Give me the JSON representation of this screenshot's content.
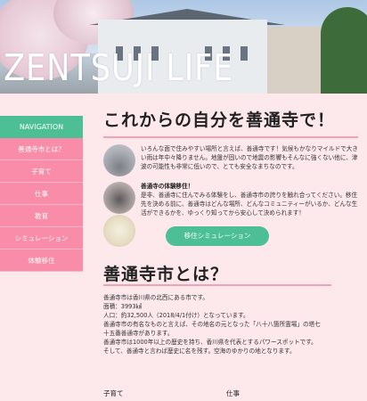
{
  "header": {
    "title": "ZENTSUJI LIFE"
  },
  "nav": {
    "heading": "NAVIGATION",
    "items": [
      {
        "label": "善通寺市とは？"
      },
      {
        "label": "子育て"
      },
      {
        "label": "仕事"
      },
      {
        "label": "教育"
      },
      {
        "label": "シミュレーション"
      },
      {
        "label": "体験移住"
      }
    ]
  },
  "intro": {
    "heading": "これからの自分を善通寺で！",
    "paragraph1": "いろんな面で住みやすい場所と言えば、善通寺です！気候もかなりマイルドで大きい雨は年中々降りません。地盤が固いので地震の影響もそんなに強くない他に、津波の可能性も非常に低いので、とても安全なまちなのです。",
    "experience_title": "善通寺の体験移住！",
    "experience_text": "是非、善通寺に住んでみる体験をし、善通寺市の誇りを触れ合ってください。移住先を決める前に、善通寺はどんな場所、どんなコミュニティーがいるか、どんな生活ができるかを、ゆっくり知ってから安心して決められます！",
    "button_label": "移住シミュレーション"
  },
  "about": {
    "heading": "善通寺市とは？",
    "lines": [
      "善通寺市は香川県の北西にある市です。",
      "面積：3993㎢",
      "人口：約32,500人（2018/4/1付け）となっています。",
      "善通寺市の有名なものと言えば、その地名の元となった「八十八箇所霊場」の塔七",
      "十五番善通寺があります。",
      "善通寺市は1000年以上の歴史を持ち、香川県を代表とするパワースポットです。",
      "そして、善通寺と言わば歴史に名を残す。空海のゆかりの地となります。"
    ]
  },
  "sections": {
    "left": "子育て",
    "right": "仕事"
  },
  "colors": {
    "background": "#fde8ec",
    "accent_green": "#4cbf96",
    "nav_pink": "#f98ca8",
    "underline_pink": "#f3a1b5"
  }
}
